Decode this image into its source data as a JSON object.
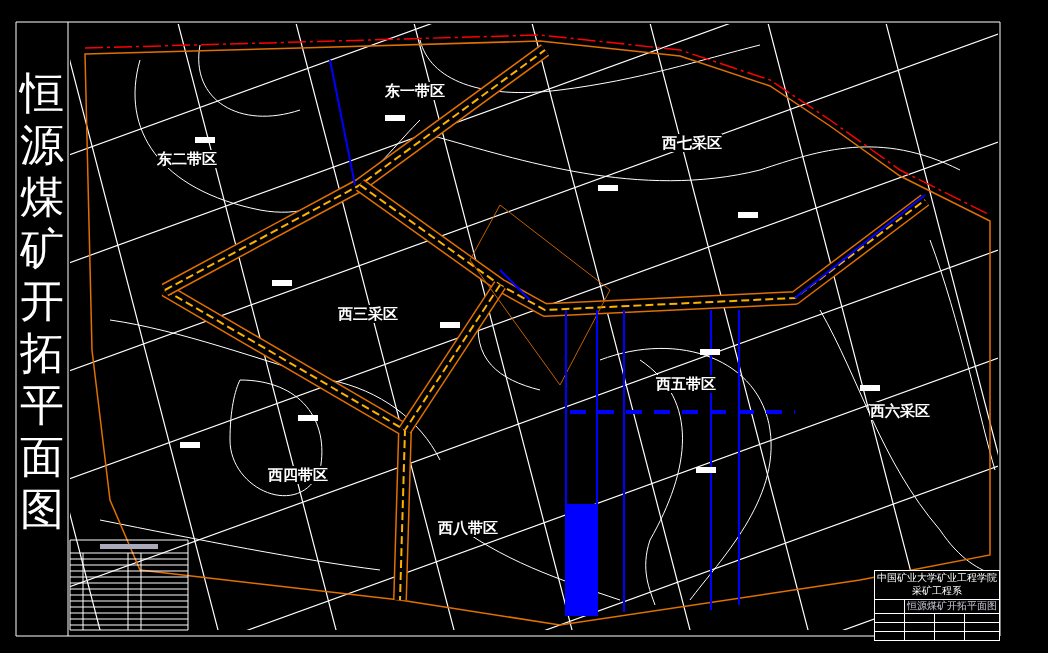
{
  "title": "恒源煤矿开拓平面图",
  "zones": [
    {
      "name": "东一带区"
    },
    {
      "name": "东二带区"
    },
    {
      "name": "西七采区"
    },
    {
      "name": "西三采区"
    },
    {
      "name": "西五带区"
    },
    {
      "name": "西六采区"
    },
    {
      "name": "西四带区"
    },
    {
      "name": "西八带区"
    }
  ],
  "title_block": {
    "institution": "中国矿业大学矿业工程学院",
    "department": "采矿工程系",
    "drawing_title": "恒源煤矿开拓平面图"
  }
}
